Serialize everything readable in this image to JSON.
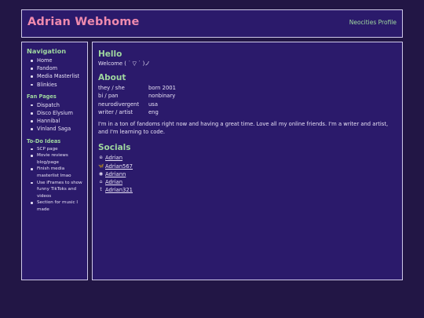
{
  "header": {
    "title": "Adrian Webhome",
    "link": "Neocities Profile"
  },
  "sidebar": {
    "nav_heading": "Navigation",
    "nav_items": [
      "Home",
      "Fandom",
      "Media Masterlist",
      "Blinkies"
    ],
    "fan_heading": "Fan Pages",
    "fan_items": [
      "Dispatch",
      "Disco Elysium",
      "Hannibal",
      "Vinland Saga"
    ],
    "todo_heading": "To-Do Ideas",
    "todo_items": [
      "SCP page",
      "Movie reviews blog/page",
      "Finish media masterlist lmao",
      "Use iFrames to show funny TikToks and videos",
      "Section for music I made"
    ]
  },
  "main": {
    "hello_heading": "Hello",
    "welcome": "Welcome ( ˙ ▽ ˙ )ノ",
    "about_heading": "About",
    "about_rows": [
      [
        "they / she",
        "born 2001"
      ],
      [
        "bi / pan",
        "nonbinary"
      ],
      [
        "neurodivergent",
        "usa"
      ],
      [
        "writer / artist",
        "eng"
      ]
    ],
    "bio": "I'm in a ton of fandoms right now and having a great time. Love all my online friends. I'm a writer and artist, and I'm learning to code.",
    "socials_heading": "Socials",
    "socials": [
      {
        "icon": "ao3-icon",
        "glyph": "ɷ",
        "handle": "Adrian"
      },
      {
        "icon": "bluesky-icon",
        "glyph": "🦋",
        "handle": "Adrian567"
      },
      {
        "icon": "discord-icon",
        "glyph": "◉",
        "handle": "Adriann"
      },
      {
        "icon": "home-icon",
        "glyph": "⌂",
        "handle": "Adrian"
      },
      {
        "icon": "tumblr-icon",
        "glyph": "t",
        "handle": "Adrian321"
      }
    ]
  }
}
